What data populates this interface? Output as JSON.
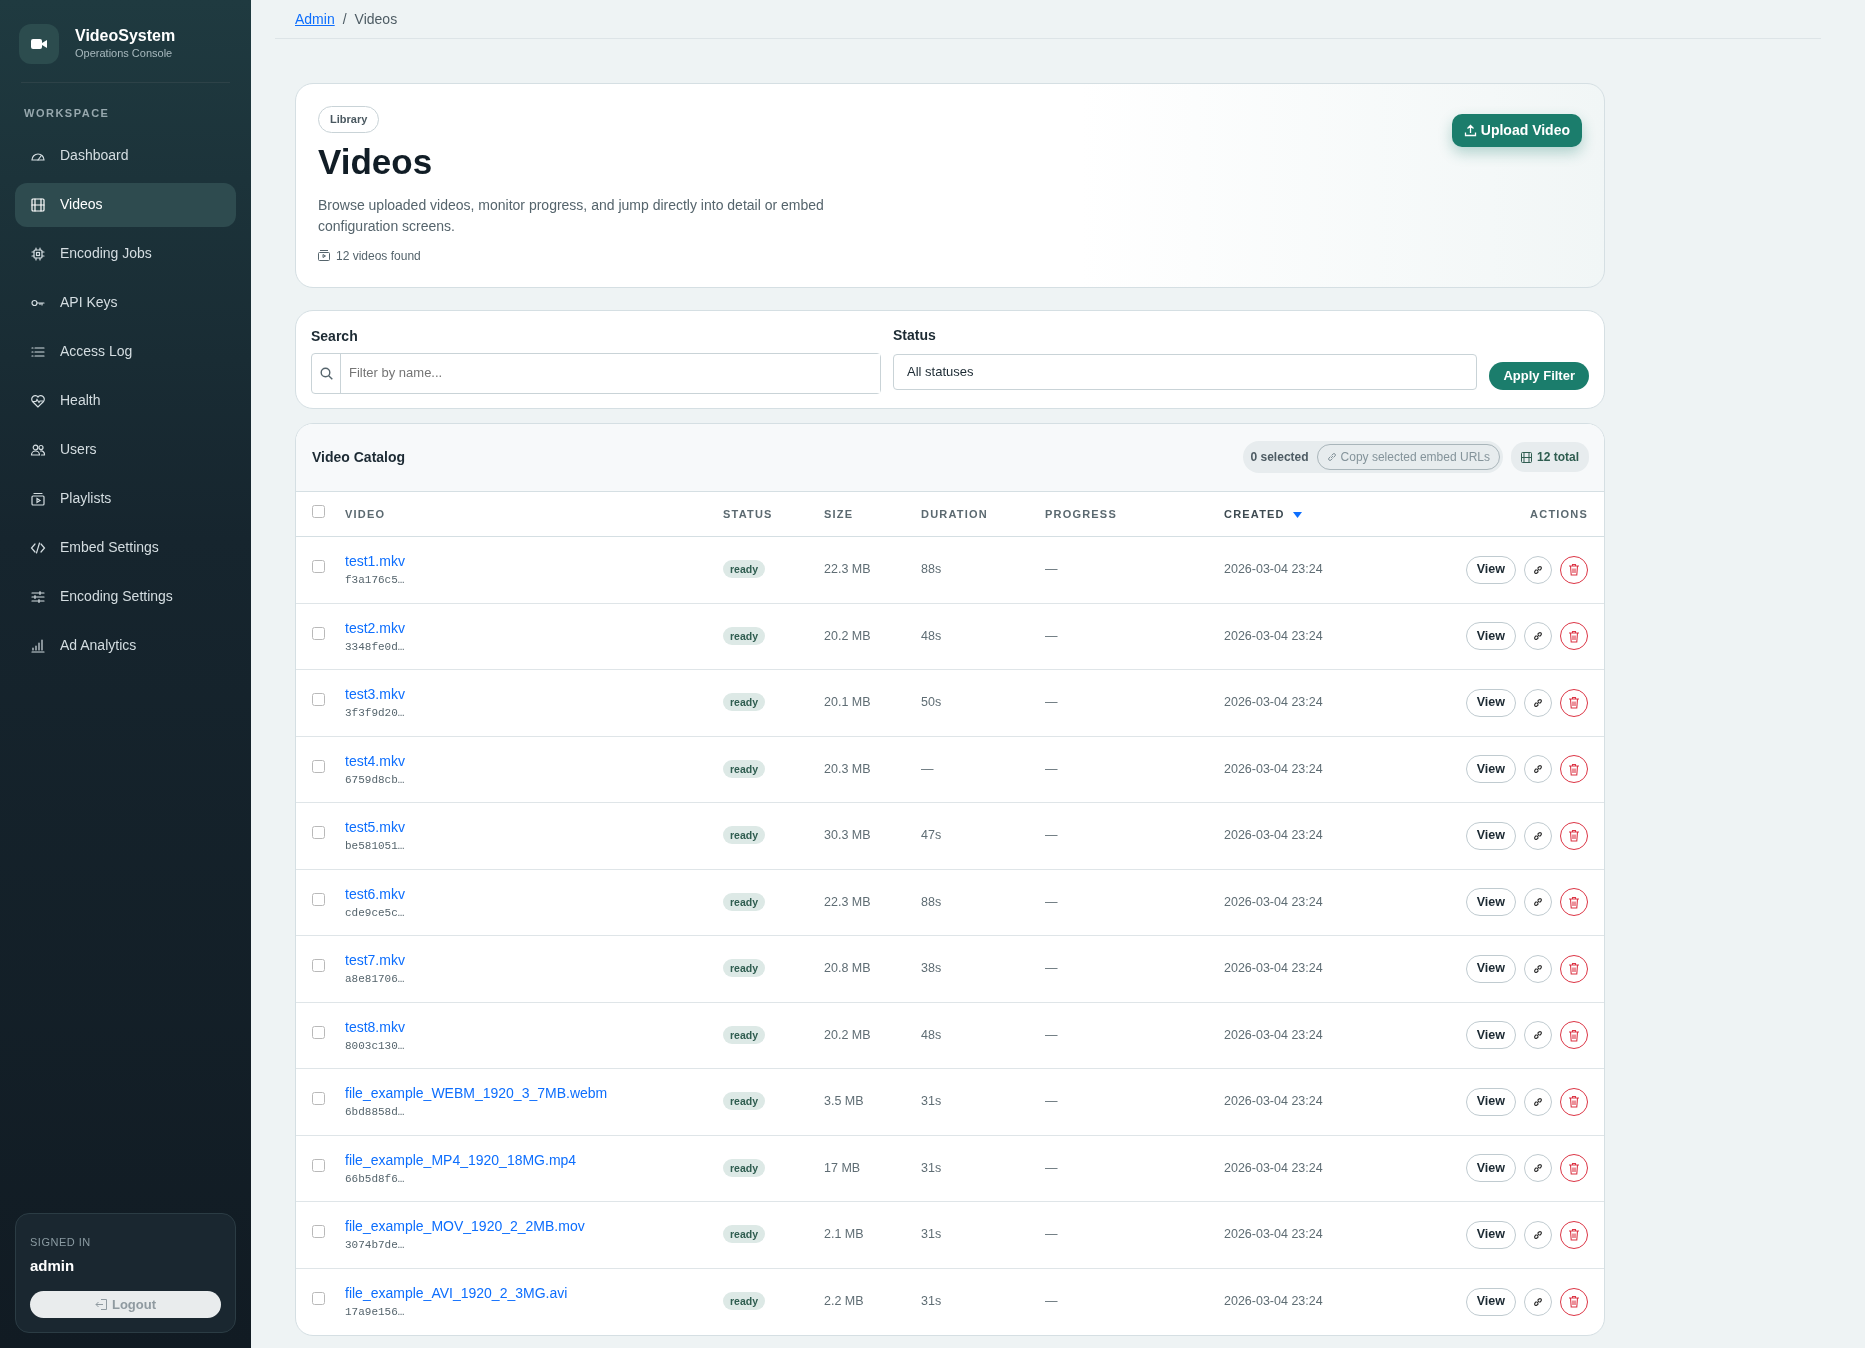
{
  "brand": {
    "title": "VideoSystem",
    "subtitle": "Operations Console"
  },
  "sidebar": {
    "section": "WORKSPACE",
    "items": [
      {
        "label": "Dashboard",
        "selected": false
      },
      {
        "label": "Videos",
        "selected": true
      },
      {
        "label": "Encoding Jobs",
        "selected": false
      },
      {
        "label": "API Keys",
        "selected": false
      },
      {
        "label": "Access Log",
        "selected": false
      },
      {
        "label": "Health",
        "selected": false
      },
      {
        "label": "Users",
        "selected": false
      },
      {
        "label": "Playlists",
        "selected": false
      },
      {
        "label": "Embed Settings",
        "selected": false
      },
      {
        "label": "Encoding Settings",
        "selected": false
      },
      {
        "label": "Ad Analytics",
        "selected": false
      }
    ]
  },
  "user": {
    "caption": "SIGNED IN",
    "name": "admin",
    "logout": "Logout"
  },
  "breadcrumb": [
    {
      "label": "Admin",
      "kind": "link"
    },
    {
      "label": "/",
      "kind": "separator"
    },
    {
      "label": "Videos",
      "kind": "current"
    }
  ],
  "header": {
    "badge": "Library",
    "title": "Videos",
    "description": "Browse uploaded videos, monitor progress, and jump directly into detail or embed configuration screens.",
    "count": "12 videos found",
    "upload": "Upload Video"
  },
  "filters": {
    "search_label": "Search",
    "search_placeholder": "Filter by name...",
    "status_label": "Status",
    "status_value": "All statuses",
    "apply": "Apply Filter"
  },
  "catalog": {
    "title": "Video Catalog",
    "selected_count": "0 selected",
    "copy": "Copy selected embed URLs",
    "total": "12 total",
    "all_checked": false,
    "columns": [
      {
        "label": "VIDEO",
        "sorted": false
      },
      {
        "label": "STATUS",
        "sorted": false
      },
      {
        "label": "SIZE",
        "sorted": false
      },
      {
        "label": "DURATION",
        "sorted": false
      },
      {
        "label": "PROGRESS",
        "sorted": false
      },
      {
        "label": "CREATED",
        "sorted": true
      },
      {
        "label": "ACTIONS",
        "sorted": false
      }
    ],
    "rows": [
      {
        "name": "test1.mkv",
        "id": "f3a176c5…",
        "status": "ready",
        "size": "22.3 MB",
        "duration": "88s",
        "progress": "—",
        "created": "2026-03-04 23:24",
        "view": "View",
        "checked": false
      },
      {
        "name": "test2.mkv",
        "id": "3348fe0d…",
        "status": "ready",
        "size": "20.2 MB",
        "duration": "48s",
        "progress": "—",
        "created": "2026-03-04 23:24",
        "view": "View",
        "checked": false
      },
      {
        "name": "test3.mkv",
        "id": "3f3f9d20…",
        "status": "ready",
        "size": "20.1 MB",
        "duration": "50s",
        "progress": "—",
        "created": "2026-03-04 23:24",
        "view": "View",
        "checked": false
      },
      {
        "name": "test4.mkv",
        "id": "6759d8cb…",
        "status": "ready",
        "size": "20.3 MB",
        "duration": "—",
        "progress": "—",
        "created": "2026-03-04 23:24",
        "view": "View",
        "checked": false
      },
      {
        "name": "test5.mkv",
        "id": "be581051…",
        "status": "ready",
        "size": "30.3 MB",
        "duration": "47s",
        "progress": "—",
        "created": "2026-03-04 23:24",
        "view": "View",
        "checked": false
      },
      {
        "name": "test6.mkv",
        "id": "cde9ce5c…",
        "status": "ready",
        "size": "22.3 MB",
        "duration": "88s",
        "progress": "—",
        "created": "2026-03-04 23:24",
        "view": "View",
        "checked": false
      },
      {
        "name": "test7.mkv",
        "id": "a8e81706…",
        "status": "ready",
        "size": "20.8 MB",
        "duration": "38s",
        "progress": "—",
        "created": "2026-03-04 23:24",
        "view": "View",
        "checked": false
      },
      {
        "name": "test8.mkv",
        "id": "8003c130…",
        "status": "ready",
        "size": "20.2 MB",
        "duration": "48s",
        "progress": "—",
        "created": "2026-03-04 23:24",
        "view": "View",
        "checked": false
      },
      {
        "name": "file_example_WEBM_1920_3_7MB.webm",
        "id": "6bd8858d…",
        "status": "ready",
        "size": "3.5 MB",
        "duration": "31s",
        "progress": "—",
        "created": "2026-03-04 23:24",
        "view": "View",
        "checked": false
      },
      {
        "name": "file_example_MP4_1920_18MG.mp4",
        "id": "66b5d8f6…",
        "status": "ready",
        "size": "17 MB",
        "duration": "31s",
        "progress": "—",
        "created": "2026-03-04 23:24",
        "view": "View",
        "checked": false
      },
      {
        "name": "file_example_MOV_1920_2_2MB.mov",
        "id": "3074b7de…",
        "status": "ready",
        "size": "2.1 MB",
        "duration": "31s",
        "progress": "—",
        "created": "2026-03-04 23:24",
        "view": "View",
        "checked": false
      },
      {
        "name": "file_example_AVI_1920_2_3MG.avi",
        "id": "17a9e156…",
        "status": "ready",
        "size": "2.2 MB",
        "duration": "31s",
        "progress": "—",
        "created": "2026-03-04 23:24",
        "view": "View",
        "checked": false
      }
    ]
  }
}
